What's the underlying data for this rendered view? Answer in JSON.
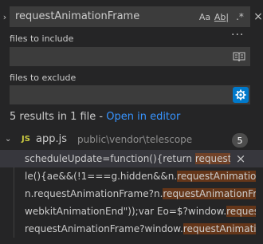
{
  "search": {
    "query": "requestAnimationFrame",
    "match_case_label": "Aa",
    "whole_word_label": "Ab|",
    "regex_label": ".*",
    "more_label": "···"
  },
  "include": {
    "label": "files to include",
    "value": ""
  },
  "exclude": {
    "label": "files to exclude",
    "value": ""
  },
  "summary": {
    "text": "5 results in 1 file - ",
    "link": "Open in editor"
  },
  "file": {
    "icon_label": "JS",
    "name": "app.js",
    "path": "public\\vendor\\telescope",
    "count": "5"
  },
  "matches": [
    {
      "before": "scheduleUpdate=function(){return ",
      "hit": "request..."
    },
    {
      "before": "le(){ae&&(!1===g.hidden&&n.",
      "hit": "requestAnimation..."
    },
    {
      "before": "n.requestAnimationFrame?n.",
      "hit": "requestAnimationFr..."
    },
    {
      "before": "webkitAnimationEnd\"));var Eo=$?window.",
      "hit": "request..."
    },
    {
      "before": "requestAnimationFrame?window.",
      "hit": "requestAnimatio..."
    }
  ],
  "colors": {
    "accent": "#007acc",
    "link": "#3794ff",
    "match_highlight": "#ea5c00",
    "js_icon": "#cbcb41"
  }
}
